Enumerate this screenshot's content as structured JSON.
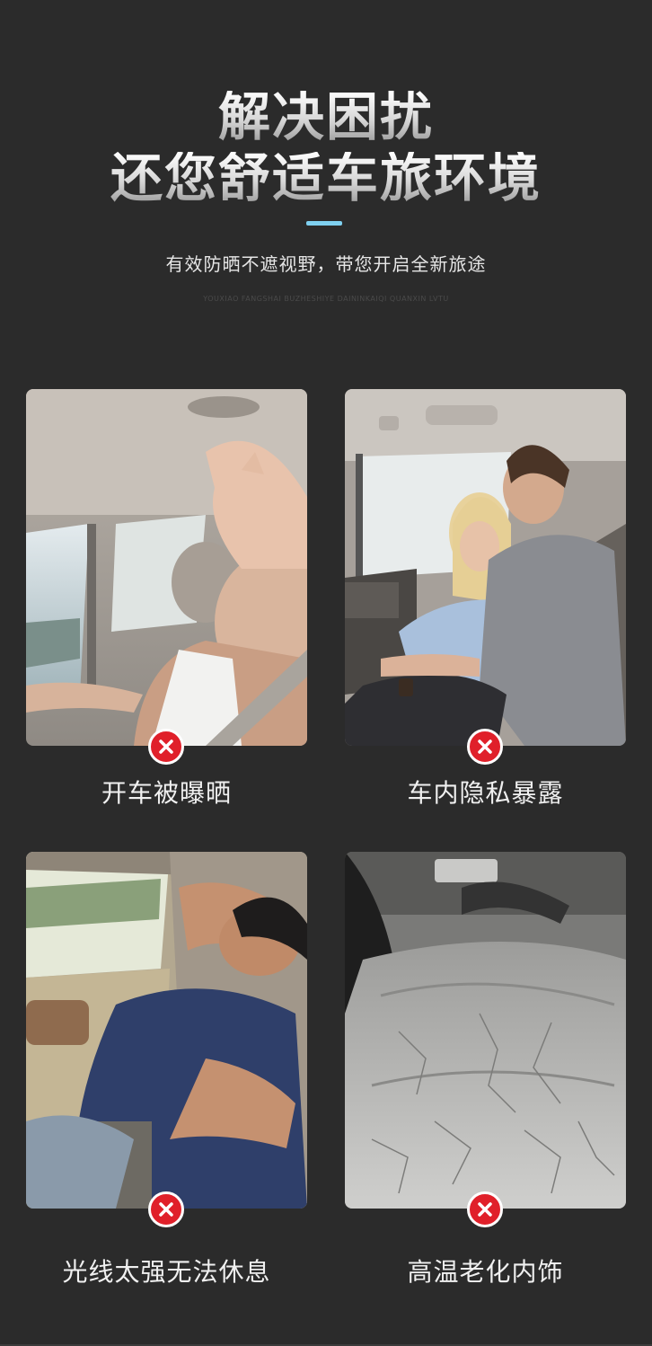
{
  "header": {
    "title_line1": "解决困扰",
    "title_line2": "还您舒适车旅环境",
    "subtitle": "有效防晒不遮视野，带您开启全新旅途",
    "pinyin": "YOUXIAO FANGSHAI BUZHESHIYE DAININKAIQI QUANXIN LVTU"
  },
  "colors": {
    "background": "#2b2b2b",
    "accent_bar": "#7fd0f0",
    "badge_red": "#e0202a"
  },
  "problems": [
    {
      "caption": "开车被曝晒",
      "image_desc": "woman-driving-shielding-eyes",
      "badge": "x-icon"
    },
    {
      "caption": "车内隐私暴露",
      "image_desc": "couple-in-back-seat",
      "badge": "x-icon"
    },
    {
      "caption": "光线太强无法休息",
      "image_desc": "man-sleeping-arm-over-eyes",
      "badge": "x-icon"
    },
    {
      "caption": "高温老化内饰",
      "image_desc": "cracked-leather-car-seat",
      "badge": "x-icon"
    }
  ]
}
